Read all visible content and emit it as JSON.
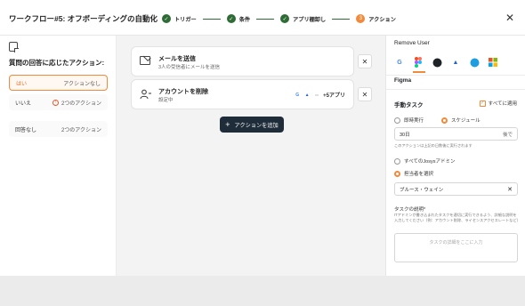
{
  "header": {
    "title": "ワークフロー#5: オフボーディングの自動化",
    "steps": [
      {
        "label": "トリガー",
        "state": "done"
      },
      {
        "label": "条件",
        "state": "done"
      },
      {
        "label": "アプリ棚卸し",
        "state": "done"
      },
      {
        "label": "アクション",
        "state": "active",
        "number": "3"
      }
    ],
    "check": "✓",
    "close": "✕"
  },
  "left": {
    "heading": "質問の回答に応じたアクション:",
    "branches": [
      {
        "label": "はい",
        "count": "アクションなし"
      },
      {
        "label": "いいえ",
        "count": "2つのアクション",
        "warning": "!"
      },
      {
        "label": "回答なし",
        "count": "2つのアクション"
      }
    ]
  },
  "center": {
    "cards": [
      {
        "title": "メールを送信",
        "subtitle": "3人の受信者にメールを送信"
      },
      {
        "title": "アカウントを削除",
        "subtitle": "設定中",
        "apps_more": "+5アプリ"
      }
    ],
    "remove": "✕",
    "add_button": "アクションを追加",
    "add_plus": "+"
  },
  "right": {
    "title": "Remove User",
    "selected_app": "Figma",
    "section_title": "手動タスク",
    "apply_all": "すべてに適用",
    "timing": {
      "immediate": "即時実行",
      "scheduled": "スケジュール",
      "selected": "scheduled"
    },
    "days_value": "30日",
    "days_suffix": "後で",
    "note": "このアクションは上記の日数後に実行されます",
    "assignee": {
      "all_admins": "すべてのJosysアドミン",
      "choose": "担当者を選択",
      "selected": "choose"
    },
    "assignee_value": "ブルース・ウェイン",
    "clear": "✕",
    "desc_label": "タスクの説明*",
    "desc_help": "ITアドミンが書き込まれたタスクを適切に実行できるよう、詳細な説明を入力してください（例：アカウント削除、ライセンスアクセスレートなど）",
    "desc_placeholder": "タスクの詳細をここに入力"
  },
  "colors": {
    "accent": "#f08a3c",
    "done": "#2f6b35",
    "dark_button": "#1f2d3a"
  }
}
